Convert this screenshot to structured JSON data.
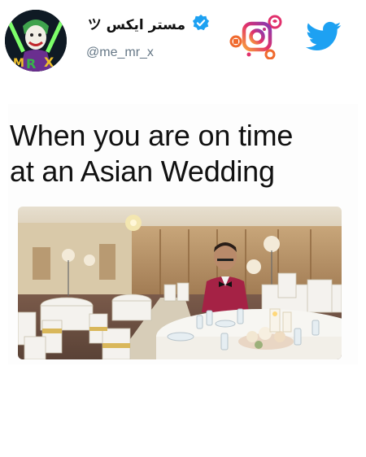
{
  "tweet": {
    "display_name": "مستر ايكس ツ",
    "handle": "@me_mr_x",
    "verified_icon": "verified-badge-icon",
    "caption_line1": "When you are on time",
    "caption_line2": "at an Asian Wedding"
  },
  "icons": {
    "avatar": "joker-avatar",
    "instagram": "instagram-icon",
    "twitter": "twitter-bird-icon"
  },
  "colors": {
    "twitter_blue": "#1DA1F2",
    "verified_blue": "#1DA1F2",
    "handle_gray": "#657786",
    "instagram_gradient": [
      "#f9a23a",
      "#e1306c",
      "#833ab4"
    ]
  },
  "photo": {
    "description_icon": "wedding-hall-photo"
  }
}
